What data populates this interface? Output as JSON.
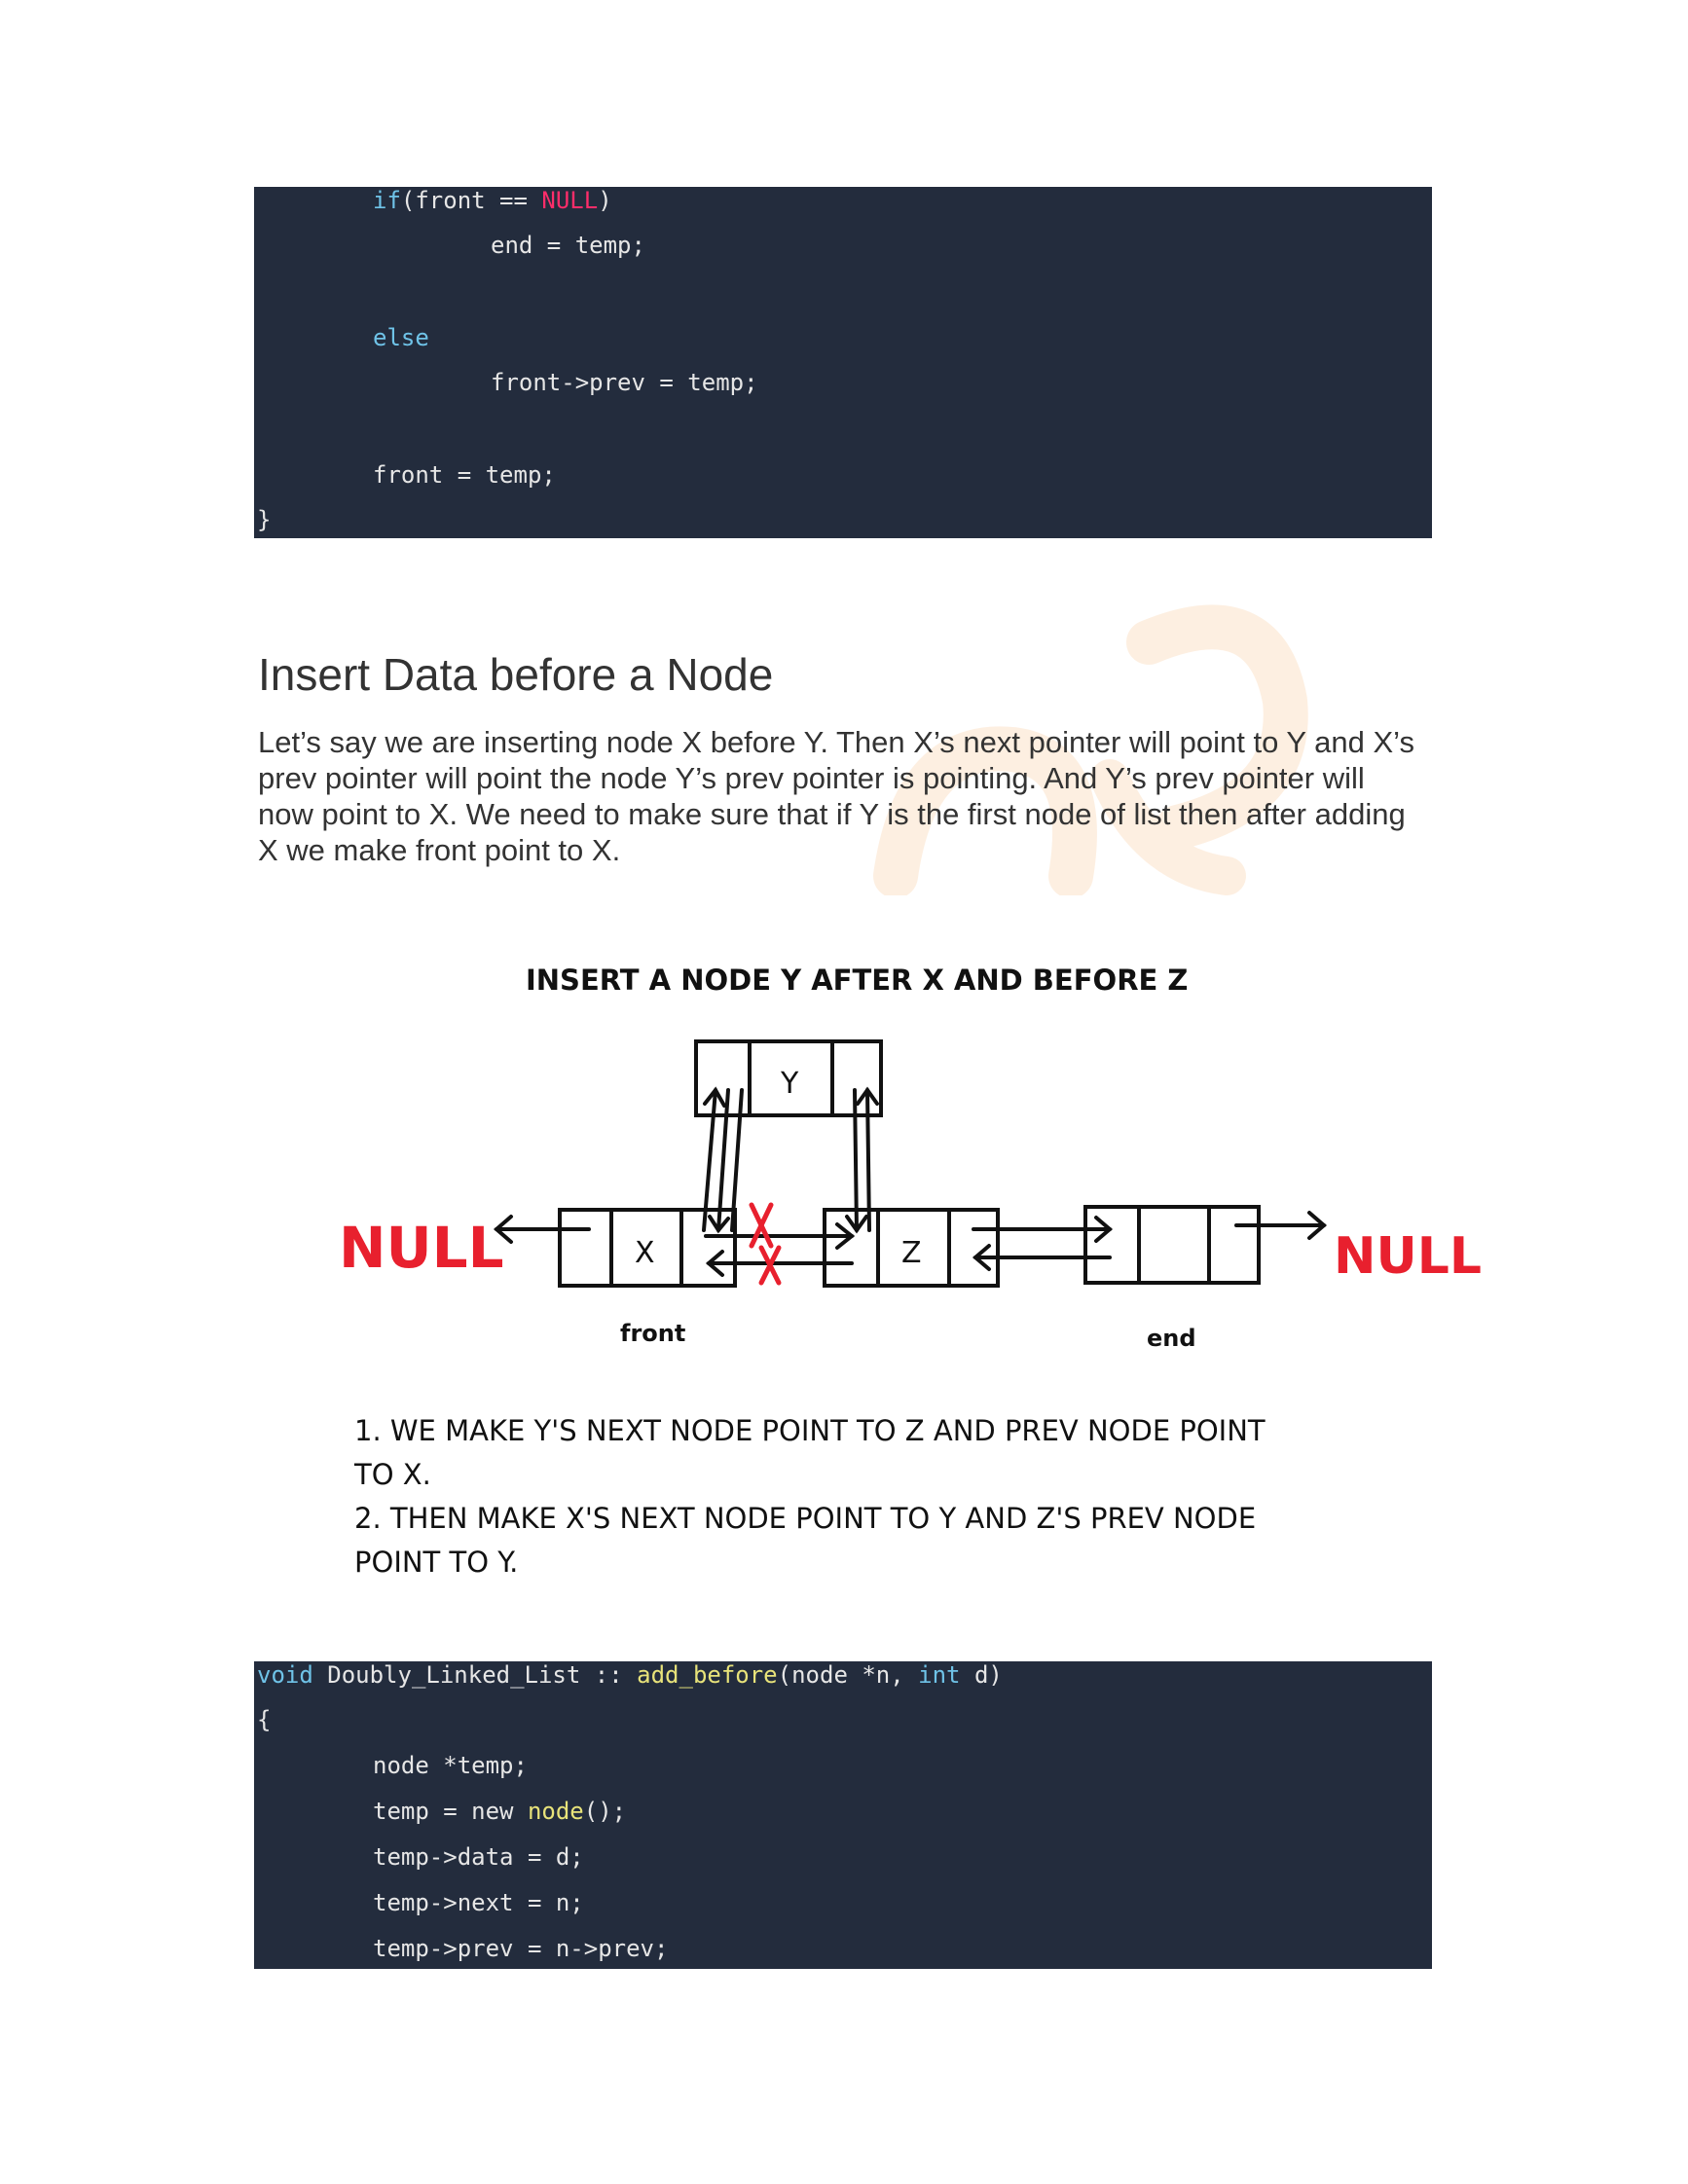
{
  "code_top": {
    "lines": [
      [
        "if",
        "(front == ",
        "NULL",
        ")"
      ],
      [
        "end = temp;"
      ],
      [
        "else"
      ],
      [
        "front->prev = temp;"
      ],
      [
        "front = temp;"
      ],
      [
        "}"
      ]
    ]
  },
  "section": {
    "heading": "Insert Data before a Node",
    "paragraph": "Let’s say we are inserting node X before Y. Then X’s next pointer will point to Y and X’s prev pointer will point the node Y’s prev pointer is pointing. And Y’s prev pointer will now point to X. We need to make sure that if Y is the first node of list then after adding X we make front point to X."
  },
  "diagram": {
    "title": "INSERT A NODE Y AFTER X AND BEFORE Z",
    "null_left": "NULL",
    "null_right": "NULL",
    "node_y": "Y",
    "node_x": "X",
    "node_z": "Z",
    "label_front": "front",
    "label_end": "end",
    "steps": [
      "1. WE MAKE Y'S NEXT NODE POINT TO Z AND PREV NODE POINT",
      "TO X.",
      "2. THEN MAKE X'S NEXT NODE POINT TO Y AND Z'S PREV NODE",
      "POINT TO Y."
    ],
    "colors": {
      "null": "#e8202e",
      "cross": "#e8202e",
      "ink": "#111111"
    }
  },
  "code_bottom": {
    "sig": {
      "kw_void": "void",
      "cls": " Doubly_Linked_List :: ",
      "fn": "add_before",
      "args1": "(node *n, ",
      "kw_int": "int",
      "args2": " d)"
    },
    "lines": [
      "{",
      "node *temp;",
      [
        "temp = new ",
        "node",
        "();"
      ],
      "temp->data = d;",
      "temp->next = n;",
      "temp->prev = n->prev;"
    ]
  },
  "colors": {
    "code_bg": "#232c3d",
    "keyword": "#6fc3e8",
    "null_literal": "#ff2d6a",
    "function": "#e8e37a"
  }
}
